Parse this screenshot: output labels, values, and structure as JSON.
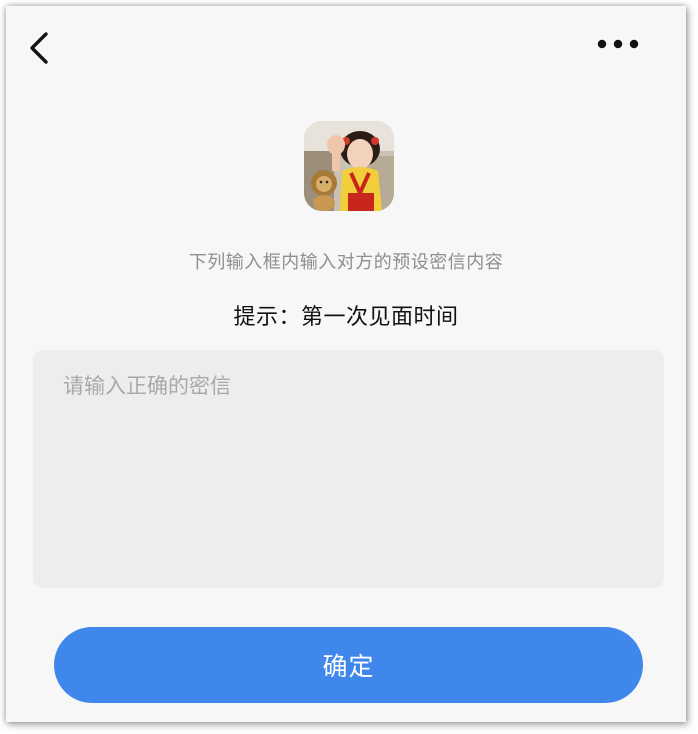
{
  "header": {
    "back_icon": "chevron-left-icon",
    "more_icon": "more-dots-icon"
  },
  "profile": {
    "avatar_description": "avatar-photo"
  },
  "instruction_text": "下列输入框内输入对方的预设密信内容",
  "hint_text": "提示：第一次见面时间",
  "secret_input": {
    "placeholder": "请输入正确的密信",
    "value": ""
  },
  "confirm_label": "确定",
  "colors": {
    "background": "#f7f7f7",
    "input_background": "#ededed",
    "button_background": "#3f87ea",
    "instruction_text": "#8e8e93",
    "hint_text": "#111111"
  }
}
